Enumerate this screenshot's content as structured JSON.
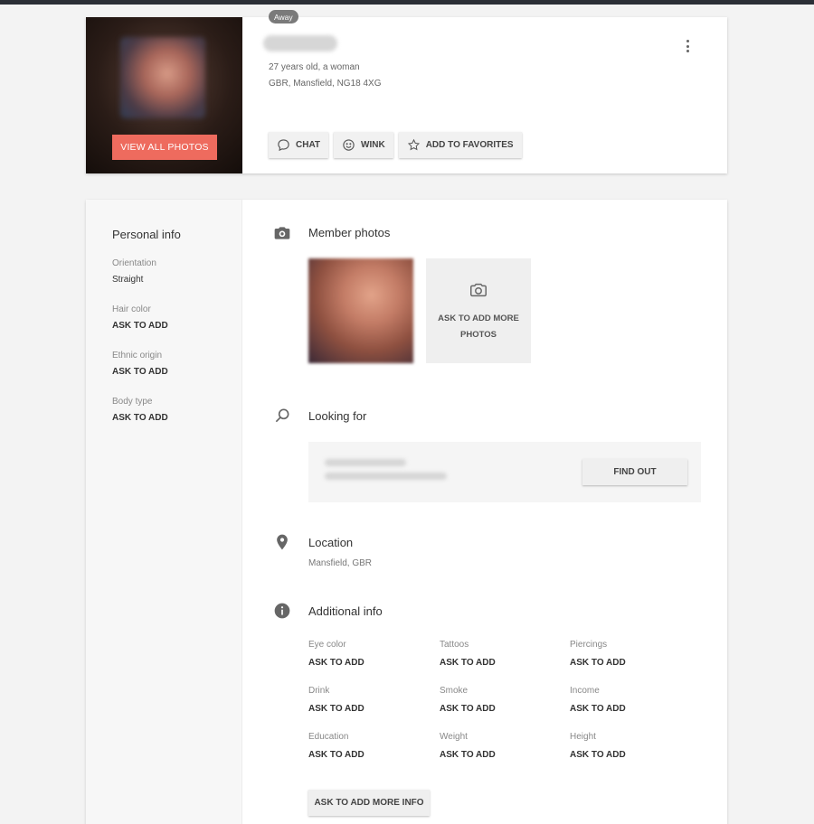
{
  "status_badge": "Away",
  "profile": {
    "age_line": "27 years old, a woman",
    "location_line": "GBR, Mansfield, NG18 4XG"
  },
  "header": {
    "view_all_photos": "VIEW ALL PHOTOS",
    "actions": [
      {
        "label": "CHAT",
        "icon": "chat-bubble-icon"
      },
      {
        "label": "WINK",
        "icon": "smiley-icon"
      },
      {
        "label": "ADD TO FAVORITES",
        "icon": "star-icon"
      }
    ],
    "menu_icon": "kebab-menu-icon"
  },
  "personal_info": {
    "title": "Personal info",
    "items": [
      {
        "label": "Orientation",
        "value": "Straight"
      },
      {
        "label": "Hair color",
        "value": "ASK TO ADD"
      },
      {
        "label": "Ethnic origin",
        "value": "ASK TO ADD"
      },
      {
        "label": "Body type",
        "value": "ASK TO ADD"
      }
    ]
  },
  "sections": {
    "member_photos": {
      "title": "Member photos",
      "icon": "camera-icon",
      "ask_more": "ASK TO ADD MORE PHOTOS"
    },
    "looking_for": {
      "title": "Looking for",
      "icon": "search-icon",
      "button": "FIND OUT"
    },
    "location": {
      "title": "Location",
      "icon": "location-pin-icon",
      "value": "Mansfield, GBR"
    },
    "additional_info": {
      "title": "Additional info",
      "icon": "info-icon",
      "items": [
        {
          "label": "Eye color",
          "value": "ASK TO ADD"
        },
        {
          "label": "Tattoos",
          "value": "ASK TO ADD"
        },
        {
          "label": "Piercings",
          "value": "ASK TO ADD"
        },
        {
          "label": "Drink",
          "value": "ASK TO ADD"
        },
        {
          "label": "Smoke",
          "value": "ASK TO ADD"
        },
        {
          "label": "Income",
          "value": "ASK TO ADD"
        },
        {
          "label": "Education",
          "value": "ASK TO ADD"
        },
        {
          "label": "Weight",
          "value": "ASK TO ADD"
        },
        {
          "label": "Height",
          "value": "ASK TO ADD"
        }
      ],
      "more_button": "ASK TO ADD MORE INFO"
    }
  },
  "colors": {
    "accent": "#ee6b5e",
    "badge": "#7a7a7a",
    "background": "#f3f3f3"
  }
}
